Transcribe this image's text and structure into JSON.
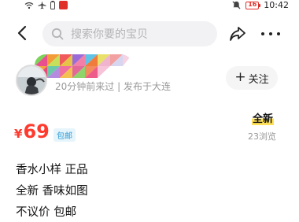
{
  "status_bar": {
    "time": "10:42",
    "battery": "16",
    "icons": [
      "wifi-icon",
      "airplane-icon",
      "battery-small-icon",
      "app-notification-icon",
      "mute-icon"
    ]
  },
  "header": {
    "search_placeholder": "搜索你要的宝贝"
  },
  "seller": {
    "meta": "20分钟前来过 | 发布于大连",
    "follow_label": "关注"
  },
  "item": {
    "currency": "¥",
    "price": "69",
    "shipping_tag": "包邮",
    "condition": "全新",
    "views": "23浏览",
    "description": [
      "香水小样 正品",
      "全新 香味如图",
      "不议价 包邮"
    ]
  },
  "colors": {
    "accent_red": "#ff3a2e",
    "tag_blue": "#2a9bd4",
    "highlight_yellow": "#ffe15a"
  }
}
